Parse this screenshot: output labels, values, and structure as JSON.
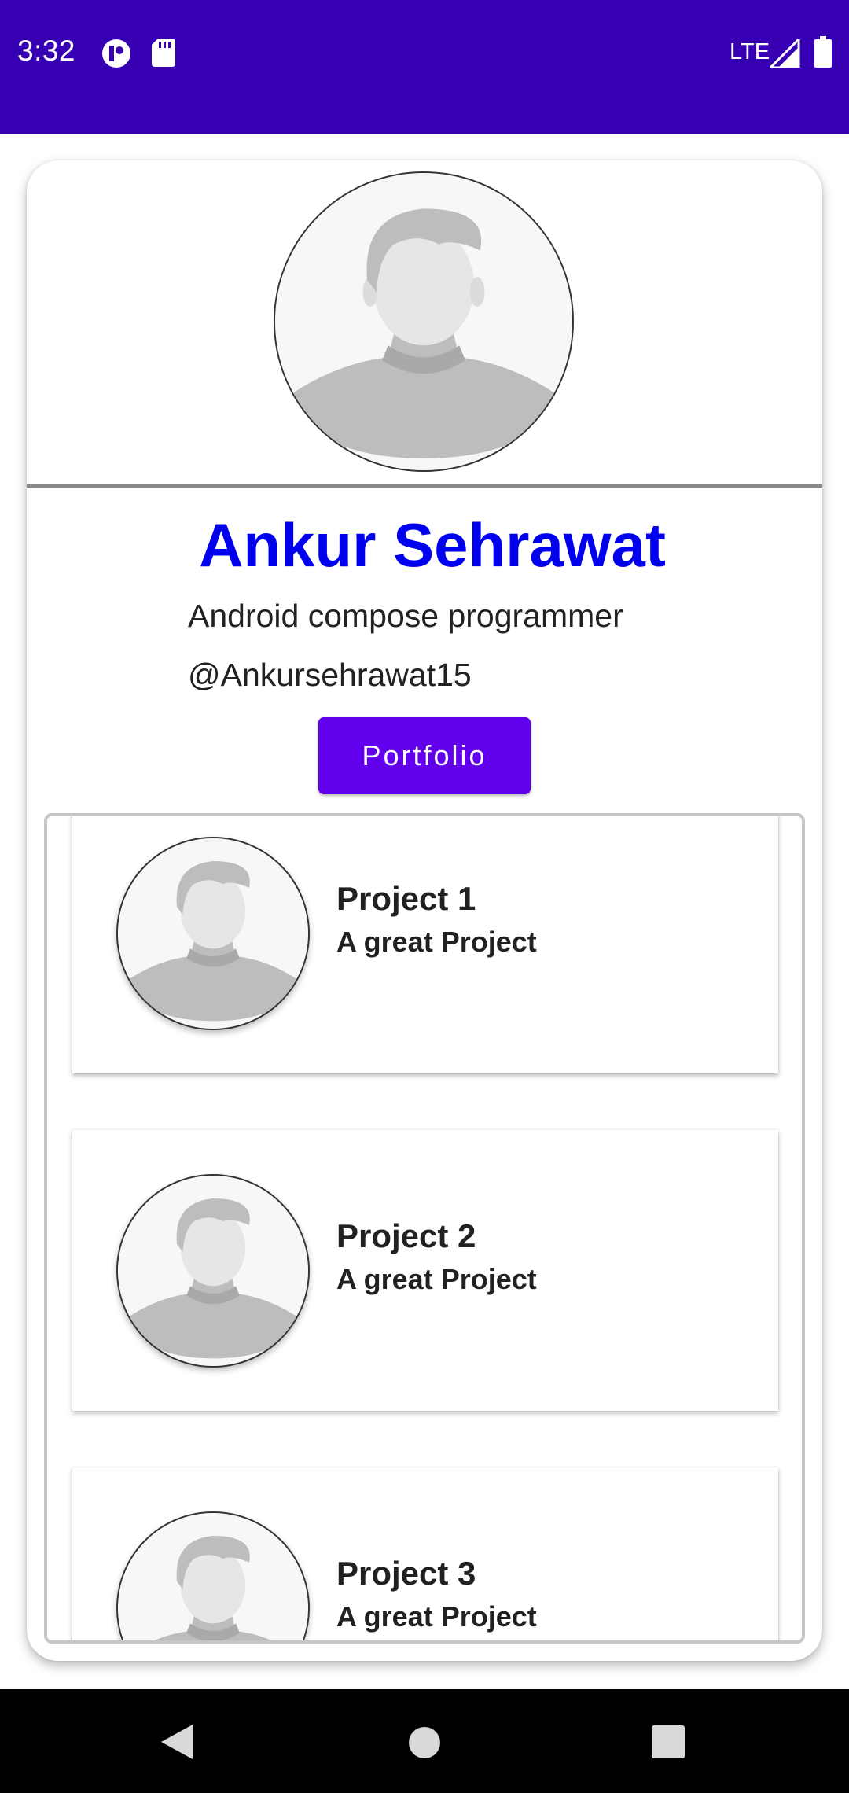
{
  "status_bar": {
    "time": "3:32",
    "network": "LTE",
    "icons": [
      "notification-app-icon",
      "sd-card-icon",
      "signal-icon",
      "battery-icon"
    ]
  },
  "profile": {
    "name": "Ankur Sehrawat",
    "role": "Android compose programmer",
    "handle": "@Ankursehrawat15",
    "button_label": "Portfolio"
  },
  "projects": [
    {
      "title": "Project 1",
      "subtitle": "A great Project"
    },
    {
      "title": "Project 2",
      "subtitle": "A great Project"
    },
    {
      "title": "Project 3",
      "subtitle": "A great Project"
    }
  ],
  "nav": {
    "icons": [
      "back-icon",
      "home-icon",
      "recents-icon"
    ]
  },
  "colors": {
    "status_bar": "#3700B3",
    "name_text": "#0000EE",
    "button": "#6200EE"
  }
}
